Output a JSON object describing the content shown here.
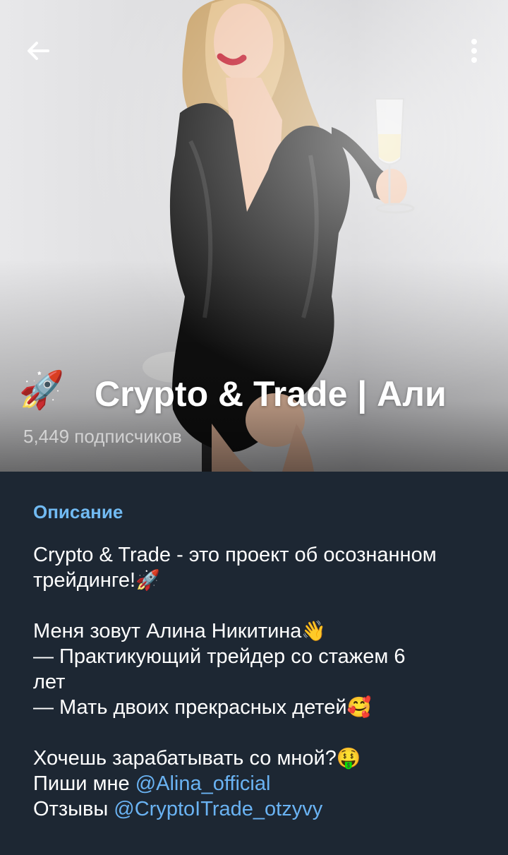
{
  "header": {
    "back_icon": "arrow-left-icon",
    "menu_icon": "vertical-dots-icon",
    "channel_avatar_emoji": "🚀",
    "channel_title": "Crypto & Trade | Али",
    "subscribers": "5,449 подписчиков"
  },
  "description": {
    "heading": "Описание",
    "lines": {
      "l1": "Crypto & Trade - это проект об осознанном",
      "l2_text": "трейдинге!",
      "l2_emoji": "🚀",
      "l3_text": "Меня зовут Алина Никитина",
      "l3_emoji": "👋",
      "l4": "— Практикующий трейдер со стажем 6",
      "l5": "лет",
      "l6_text": "— Мать двоих прекрасных детей",
      "l6_emoji": "🥰",
      "l7_text": "Хочешь зарабатывать со мной?",
      "l7_emoji": "🤑",
      "l8_prefix": "Пиши мне ",
      "l8_link": "@Alina_official",
      "l9_prefix": "Отзывы ",
      "l9_link": "@CryptoITrade_otzyvy"
    }
  },
  "colors": {
    "background": "#1d2733",
    "heading_accent": "#71baf2",
    "link": "#6ab3f3"
  }
}
